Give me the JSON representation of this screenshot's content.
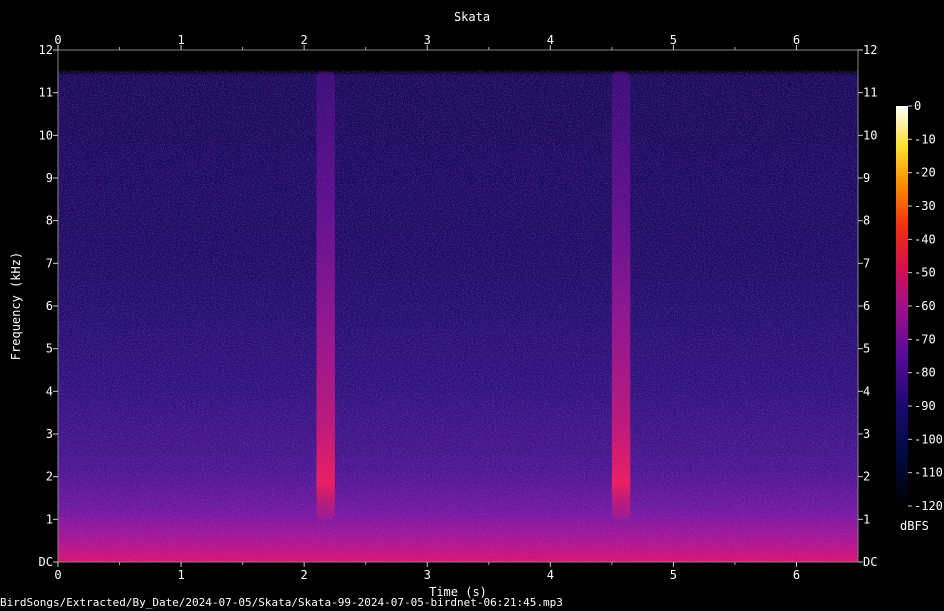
{
  "chart_data": {
    "type": "heatmap",
    "title": "Skata",
    "xlabel": "Time (s)",
    "ylabel": "Frequency (kHz)",
    "x_ticks": [
      "0",
      "1",
      "2",
      "3",
      "4",
      "5",
      "6"
    ],
    "x_tick_values": [
      0,
      1,
      2,
      3,
      4,
      5,
      6
    ],
    "y_ticks": [
      "DC",
      "1",
      "2",
      "3",
      "4",
      "5",
      "6",
      "7",
      "8",
      "9",
      "10",
      "11",
      "12"
    ],
    "y_tick_values": [
      0,
      1,
      2,
      3,
      4,
      5,
      6,
      7,
      8,
      9,
      10,
      11,
      12
    ],
    "xlim": [
      0,
      6.5
    ],
    "ylim": [
      0,
      12
    ],
    "colorbar": {
      "label": "dBFS",
      "ticks": [
        "0",
        "-10",
        "-20",
        "-30",
        "-40",
        "-50",
        "-60",
        "-70",
        "-80",
        "-90",
        "-100",
        "-110",
        "-120"
      ],
      "tick_values": [
        0,
        -10,
        -20,
        -30,
        -40,
        -50,
        -60,
        -70,
        -80,
        -90,
        -100,
        -110,
        -120
      ],
      "range": [
        -120,
        0
      ]
    },
    "calls": [
      {
        "start_s": 2.1,
        "end_s": 2.25,
        "freq_low_khz": 1.0,
        "freq_high_khz": 11.5
      },
      {
        "start_s": 4.5,
        "end_s": 4.65,
        "freq_low_khz": 1.0,
        "freq_high_khz": 11.5
      }
    ]
  },
  "footer": {
    "file_path": "BirdSongs/Extracted/By_Date/2024-07-05/Skata/Skata-99-2024-07-05-birdnet-06:21:45.mp3"
  }
}
